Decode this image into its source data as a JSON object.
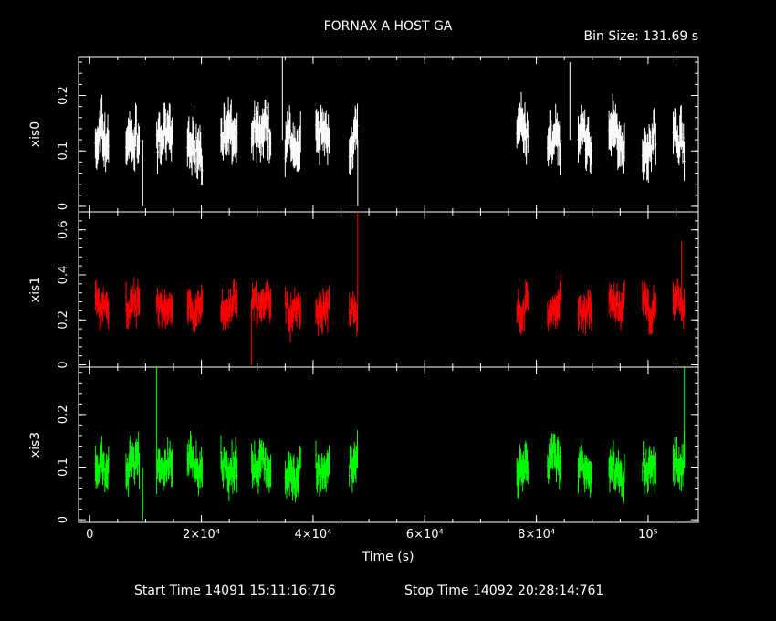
{
  "header": {
    "title": "FORNAX A HOST GA",
    "bin_size": "Bin Size: 131.69 s"
  },
  "footer": {
    "start_time": "Start Time 14091 15:11:16:716",
    "stop_time": "Stop Time 14092 20:28:14:761"
  },
  "chart_data": {
    "type": "scatter",
    "xlabel": "Time (s)",
    "xlim": [
      -2000,
      109000
    ],
    "x_ticks": [
      {
        "value": 0,
        "label": "0"
      },
      {
        "value": 20000,
        "label": "2×10⁴"
      },
      {
        "value": 40000,
        "label": "4×10⁴"
      },
      {
        "value": 60000,
        "label": "6×10⁴"
      },
      {
        "value": 80000,
        "label": "8×10⁴"
      },
      {
        "value": 100000,
        "label": "10⁵"
      }
    ],
    "segments": [
      [
        1000,
        3500
      ],
      [
        6500,
        9000
      ],
      [
        12000,
        14800
      ],
      [
        17500,
        20200
      ],
      [
        23500,
        26500
      ],
      [
        29000,
        32500
      ],
      [
        35000,
        37800
      ],
      [
        40500,
        43000
      ],
      [
        46500,
        48000
      ],
      [
        76500,
        78500
      ],
      [
        82000,
        84500
      ],
      [
        87500,
        90000
      ],
      [
        93000,
        95800
      ],
      [
        99000,
        101500
      ],
      [
        104500,
        106500
      ]
    ],
    "series": [
      {
        "name": "xis0",
        "color": "#ffffff",
        "ylim": [
          -0.01,
          0.27
        ],
        "yticks": [
          0,
          0.1,
          0.2
        ],
        "ytick_labels": [
          "0",
          "0.1",
          "0.2"
        ],
        "baseline": 0.12,
        "noise": 0.035,
        "spikes": [
          {
            "x": 34500,
            "y": 0.27
          },
          {
            "x": 86000,
            "y": 0.26
          },
          {
            "x": 9500,
            "y": 0.0
          },
          {
            "x": 48000,
            "y": 0.0
          }
        ]
      },
      {
        "name": "xis1",
        "color": "#ff0000",
        "ylim": [
          -0.01,
          0.68
        ],
        "yticks": [
          0,
          0.2,
          0.4,
          0.6
        ],
        "ytick_labels": [
          "0",
          "0.2",
          "0.4",
          "0.6"
        ],
        "baseline": 0.25,
        "noise": 0.06,
        "spikes": [
          {
            "x": 48000,
            "y": 0.68
          },
          {
            "x": 29000,
            "y": 0.0
          },
          {
            "x": 106000,
            "y": 0.55
          }
        ]
      },
      {
        "name": "xis3",
        "color": "#00ff00",
        "ylim": [
          -0.005,
          0.29
        ],
        "yticks": [
          0,
          0.1,
          0.2
        ],
        "ytick_labels": [
          "0",
          "0.1",
          "0.2"
        ],
        "baseline": 0.1,
        "noise": 0.03,
        "spikes": [
          {
            "x": 12000,
            "y": 0.29
          },
          {
            "x": 106500,
            "y": 0.29
          },
          {
            "x": 9500,
            "y": 0.0
          }
        ]
      }
    ]
  }
}
